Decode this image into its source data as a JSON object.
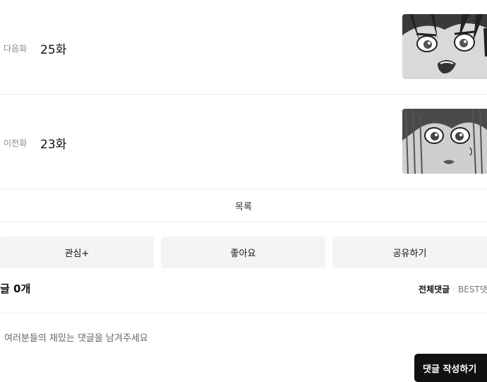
{
  "episodes": {
    "next": {
      "label": "다음화",
      "number": "25화"
    },
    "prev": {
      "label": "이전화",
      "number": "23화"
    }
  },
  "list_link": "목록",
  "actions": {
    "interest": "관심+",
    "like": "좋아요",
    "share": "공유하기"
  },
  "comments": {
    "count_text": "글 0개",
    "sort_all": "전체댓글",
    "sort_best": "BEST댓",
    "placeholder": "여러분들의 재밌는 댓글을 남겨주세요",
    "write_button": "댓글 작성하기"
  }
}
